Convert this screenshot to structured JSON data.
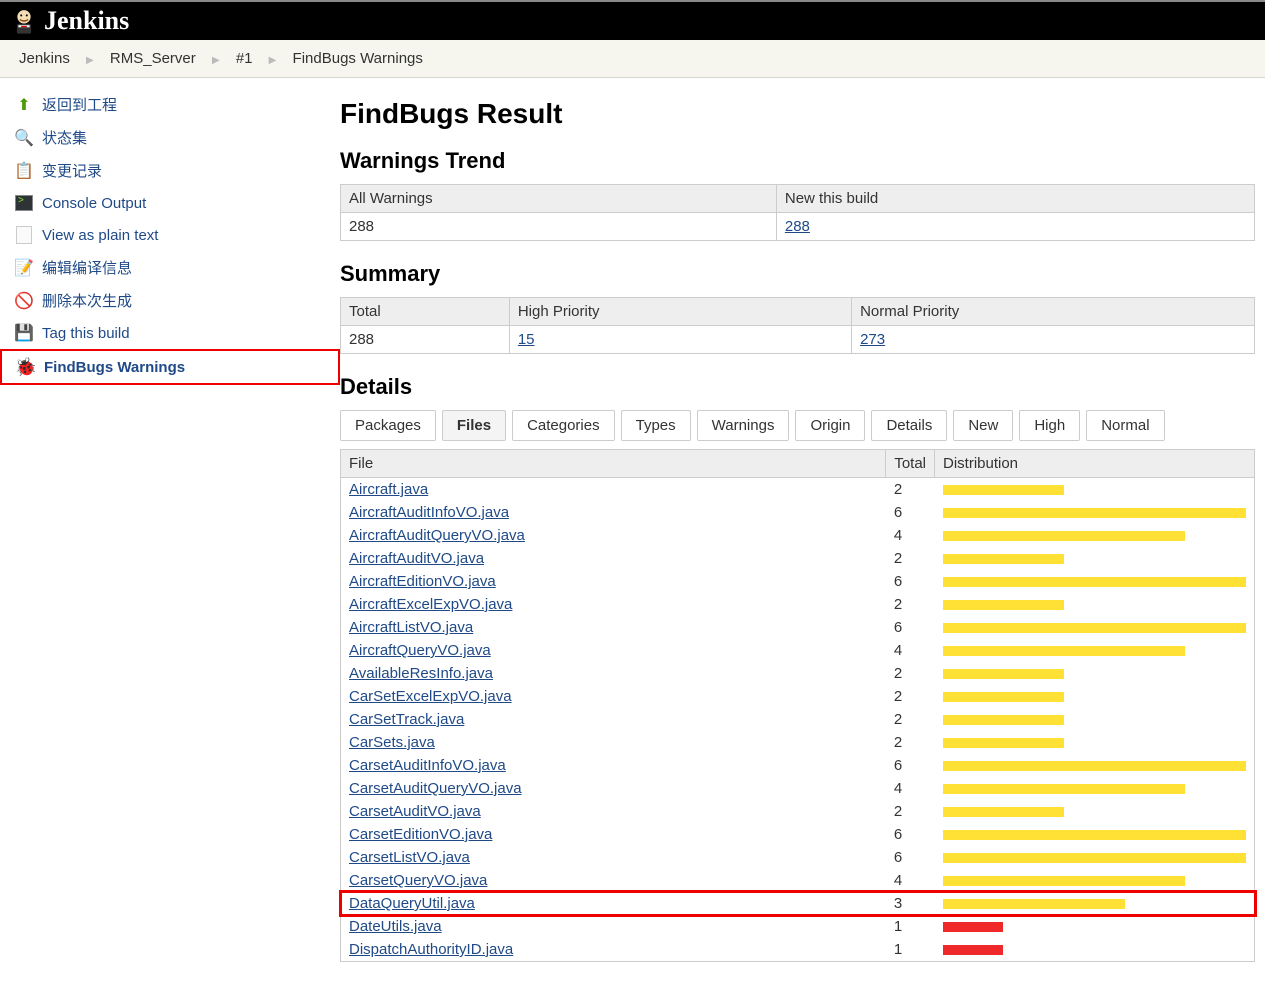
{
  "header": {
    "title": "Jenkins"
  },
  "breadcrumb": [
    "Jenkins",
    "RMS_Server",
    "#1",
    "FindBugs Warnings"
  ],
  "sidebar": {
    "items": [
      {
        "label": "返回到工程",
        "icon": "green-arrow-up"
      },
      {
        "label": "状态集",
        "icon": "magnifier"
      },
      {
        "label": "变更记录",
        "icon": "clipboard"
      },
      {
        "label": "Console Output",
        "icon": "terminal"
      },
      {
        "label": "View as plain text",
        "icon": "doc"
      },
      {
        "label": "编辑编译信息",
        "icon": "pencil"
      },
      {
        "label": "删除本次生成",
        "icon": "forbid"
      },
      {
        "label": "Tag this build",
        "icon": "disk"
      },
      {
        "label": "FindBugs Warnings",
        "icon": "bug",
        "active": true
      }
    ]
  },
  "main": {
    "title": "FindBugs Result",
    "trend": {
      "title": "Warnings Trend",
      "headers": [
        "All Warnings",
        "New this build"
      ],
      "values": {
        "all": "288",
        "new": "288"
      }
    },
    "summary": {
      "title": "Summary",
      "headers": [
        "Total",
        "High Priority",
        "Normal Priority"
      ],
      "values": {
        "total": "288",
        "high": "15",
        "normal": "273"
      }
    },
    "details": {
      "title": "Details",
      "tabs": [
        "Packages",
        "Files",
        "Categories",
        "Types",
        "Warnings",
        "Origin",
        "Details",
        "New",
        "High",
        "Normal"
      ],
      "active_tab": "Files",
      "columns": [
        "File",
        "Total",
        "Distribution"
      ],
      "rows": [
        {
          "file": "Aircraft.java",
          "total": 2,
          "bar": 40,
          "color": "yellow"
        },
        {
          "file": "AircraftAuditInfoVO.java",
          "total": 6,
          "bar": 100,
          "color": "yellow"
        },
        {
          "file": "AircraftAuditQueryVO.java",
          "total": 4,
          "bar": 80,
          "color": "yellow"
        },
        {
          "file": "AircraftAuditVO.java",
          "total": 2,
          "bar": 40,
          "color": "yellow"
        },
        {
          "file": "AircraftEditionVO.java",
          "total": 6,
          "bar": 100,
          "color": "yellow"
        },
        {
          "file": "AircraftExcelExpVO.java",
          "total": 2,
          "bar": 40,
          "color": "yellow"
        },
        {
          "file": "AircraftListVO.java",
          "total": 6,
          "bar": 100,
          "color": "yellow"
        },
        {
          "file": "AircraftQueryVO.java",
          "total": 4,
          "bar": 80,
          "color": "yellow"
        },
        {
          "file": "AvailableResInfo.java",
          "total": 2,
          "bar": 40,
          "color": "yellow"
        },
        {
          "file": "CarSetExcelExpVO.java",
          "total": 2,
          "bar": 40,
          "color": "yellow"
        },
        {
          "file": "CarSetTrack.java",
          "total": 2,
          "bar": 40,
          "color": "yellow"
        },
        {
          "file": "CarSets.java",
          "total": 2,
          "bar": 40,
          "color": "yellow"
        },
        {
          "file": "CarsetAuditInfoVO.java",
          "total": 6,
          "bar": 100,
          "color": "yellow"
        },
        {
          "file": "CarsetAuditQueryVO.java",
          "total": 4,
          "bar": 80,
          "color": "yellow"
        },
        {
          "file": "CarsetAuditVO.java",
          "total": 2,
          "bar": 40,
          "color": "yellow"
        },
        {
          "file": "CarsetEditionVO.java",
          "total": 6,
          "bar": 100,
          "color": "yellow"
        },
        {
          "file": "CarsetListVO.java",
          "total": 6,
          "bar": 100,
          "color": "yellow"
        },
        {
          "file": "CarsetQueryVO.java",
          "total": 4,
          "bar": 80,
          "color": "yellow"
        },
        {
          "file": "DataQueryUtil.java",
          "total": 3,
          "bar": 60,
          "color": "yellow",
          "highlight": true
        },
        {
          "file": "DateUtils.java",
          "total": 1,
          "bar": 20,
          "color": "red"
        },
        {
          "file": "DispatchAuthorityID.java",
          "total": 1,
          "bar": 20,
          "color": "red"
        }
      ]
    }
  }
}
